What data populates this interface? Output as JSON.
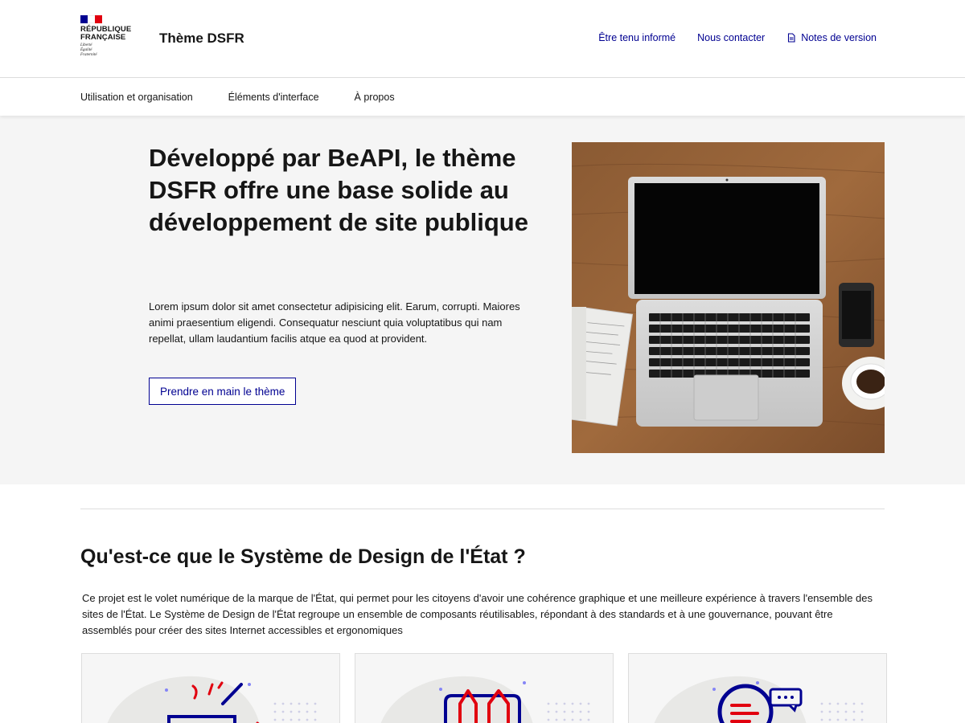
{
  "header": {
    "logo": {
      "line1": "RÉPUBLIQUE",
      "line2": "FRANÇAISE",
      "motto": [
        "Liberté",
        "Égalité",
        "Fraternité"
      ],
      "flag_colors": [
        "#000091",
        "#ffffff",
        "#e1000f"
      ]
    },
    "site_title": "Thème DSFR",
    "quick_links": [
      {
        "label": "Être tenu informé"
      },
      {
        "label": "Nous contacter"
      },
      {
        "label": "Notes de version",
        "icon": "document-icon"
      }
    ]
  },
  "nav": {
    "items": [
      {
        "label": "Utilisation et organisation"
      },
      {
        "label": "Éléments d'interface"
      },
      {
        "label": "À propos"
      }
    ]
  },
  "hero": {
    "title": "Développé par BeAPI, le thème DSFR offre une base solide au développement de site publique",
    "text": "Lorem ipsum dolor sit amet consectetur adipisicing elit. Earum, corrupti. Maiores animi praesentium eligendi. Consequatur nesciunt quia voluptatibus qui nam repellat, ullam laudantium facilis atque ea quod at provident.",
    "button_label": "Prendre en main le thème",
    "image": "laptop-on-wooden-desk"
  },
  "section": {
    "title": "Qu'est-ce que le Système de Design de l'État ?",
    "text": "Ce projet est le volet numérique de la marque de l'État, qui permet pour les citoyens d'avoir une cohérence graphique et une meilleure expérience à travers l'ensemble des sites de l'État. Le Système de Design de l'État regroupe un ensemble de composants réutilisables, répondant à des standards et à une gouvernance, pouvant être assemblés pour créer des sites Internet accessibles et ergonomiques",
    "cards": [
      {
        "icon": "tools-pictogram-icon"
      },
      {
        "icon": "design-pencils-pictogram-icon"
      },
      {
        "icon": "conversation-pictogram-icon"
      }
    ]
  },
  "colors": {
    "primary": "#000091",
    "accent_red": "#e1000f",
    "hero_background": "#f5f5f5",
    "border": "#dddddd"
  }
}
